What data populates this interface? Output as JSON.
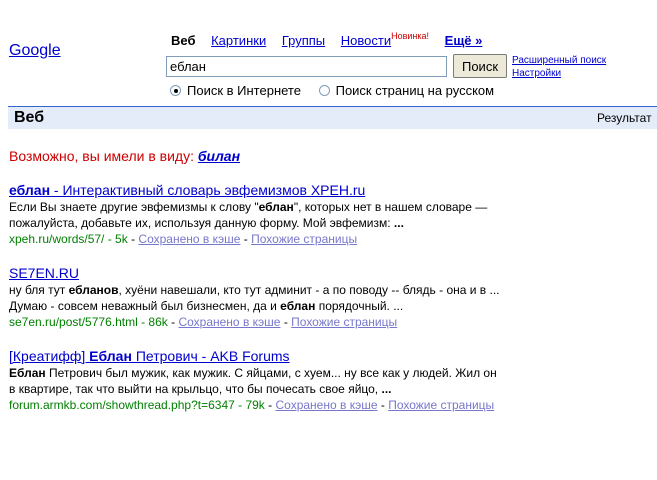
{
  "logo": {
    "text": "Google"
  },
  "tabs": {
    "active": "Веб",
    "images": "Картинки",
    "groups": "Группы",
    "news": "Новости",
    "news_badge": "Новинка!",
    "more": "Ещё »"
  },
  "search": {
    "value": "еблан",
    "button": "Поиск",
    "advanced": "Расширенный поиск",
    "settings": "Настройки"
  },
  "scope": {
    "web": "Поиск в Интернете",
    "russian": "Поиск страниц на русском",
    "selected": "web"
  },
  "bar": {
    "title": "Веб",
    "results": "Результат"
  },
  "didyoumean": {
    "prefix": "Возможно, вы имели в виду:",
    "suggestion": "билан"
  },
  "results": [
    {
      "title_bold": "еблан",
      "title_rest": " - Интерактивный словарь эвфемизмов ХРЕН.ru",
      "snippet_lines": [
        [
          "Если Вы знаете другие эвфемизмы к слову \"",
          "еблан",
          "\", которых нет в нашем словаре —"
        ],
        [
          "пожалуйста, добавьте их, используя данную форму. Мой эвфемизм: ",
          "...",
          ""
        ]
      ],
      "url": "xpeh.ru/words/57/ - 5k",
      "cache": "Сохранено в кэше",
      "similar": "Похожие страницы"
    },
    {
      "title_bold": "",
      "title_rest": "SE7EN.RU",
      "snippet_lines": [
        [
          "ну бля тут ",
          "ебланов",
          ", хуёни навешали, кто тут админит - а по поводу -- блядь - она и в ..."
        ],
        [
          "Думаю - совсем неважный был бизнесмен, да и ",
          "еблан",
          " порядочный. ..."
        ]
      ],
      "url": "se7en.ru/post/5776.html - 86k",
      "cache": "Сохранено в кэше",
      "similar": "Похожие страницы"
    },
    {
      "title_pre": "[Креатифф] ",
      "title_bold": "Еблан",
      "title_rest": " Петрович - AKB Forums",
      "snippet_lines": [
        [
          "",
          "Еблан",
          " Петрович был мужик, как мужик. С яйцами, с хуем... ну все как у людей. Жил он"
        ],
        [
          "в квартире, так что выйти на крыльцо, что бы почесать свое яйцо, ",
          "...",
          ""
        ]
      ],
      "url": "forum.armkb.com/showthread.php?t=6347 - 79k",
      "cache": "Сохранено в кэше",
      "similar": "Похожие страницы"
    }
  ]
}
